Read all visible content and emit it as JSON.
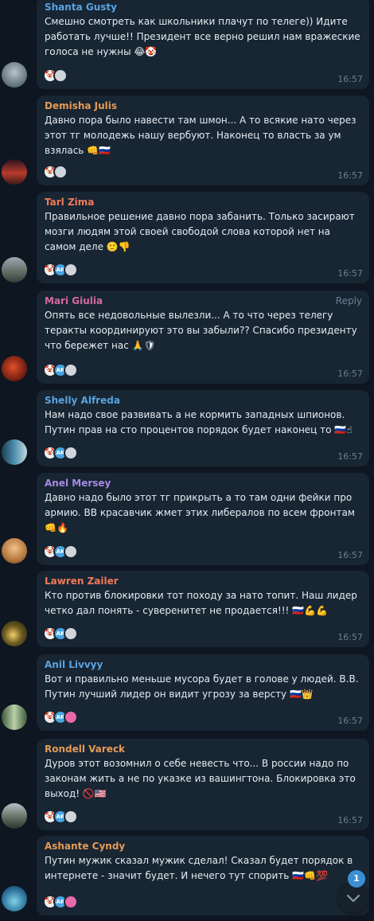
{
  "messages": [
    {
      "author": "Shanta Gusty",
      "color": "#5aa3e0",
      "text": "Смешно смотреть как школьники плачут по телеге)) Идите работать лучше!! Президент все верно решил нам вражеские голоса не нужны 😂🤡",
      "time": "16:57",
      "reactions": [
        "clown",
        "bw"
      ],
      "reply": ""
    },
    {
      "author": "Demisha Julis",
      "color": "#e59b55",
      "text": "Давно пора было навести там шмон... А то всякие нато через этот тг молодежь нашу вербуют. Наконец то власть за ум взялась 👊🇷🇺",
      "time": "16:57",
      "reactions": [
        "clown",
        "bw"
      ],
      "reply": ""
    },
    {
      "author": "Tarl Zima",
      "color": "#f07a5a",
      "text": "Правильное решение давно пора забанить. Только засирают мозги людям этой своей свободой слова которой нет на самом деле 🙂👎",
      "time": "16:57",
      "reactions": [
        "clown",
        "ak",
        "bw"
      ],
      "reply": ""
    },
    {
      "author": "Mari Giulia",
      "color": "#d46ba0",
      "text": "Опять все недовольные вылезли... А то что через телегу теракты координируют это вы забыли?? Спасибо президенту что бережет нас 🙏🛡",
      "time": "16:57",
      "reactions": [
        "clown",
        "ak",
        "bw"
      ],
      "reply": "Reply"
    },
    {
      "author": "Shelly Alfreda",
      "color": "#5aa3e0",
      "text": "Нам надо свое развивать а не кормить западных шпионов. Путин прав на сто процентов порядок будет наконец то 🇷🇺☝",
      "time": "16:57",
      "reactions": [
        "clown",
        "ak",
        "bw"
      ],
      "reply": ""
    },
    {
      "author": "Anel Mersey",
      "color": "#a58ae6",
      "text": "Давно надо было этот тг прикрыть а то там одни фейки про армию. ВВ красавчик жмет этих либералов по всем фронтам 👊🔥",
      "time": "16:57",
      "reactions": [
        "clown",
        "ak",
        "bw"
      ],
      "reply": ""
    },
    {
      "author": "Lawren Zailer",
      "color": "#f07a5a",
      "text": "Кто против блокировки тот походу за нато топит. Наш лидер четко дал понять - суверенитет не продается!!! 🇷🇺💪💪",
      "time": "16:57",
      "reactions": [
        "clown",
        "ak",
        "bw"
      ],
      "reply": ""
    },
    {
      "author": "Anil Livvyy",
      "color": "#5aa3e0",
      "text": "Вот и правильно меньше мусора будет в голове у людей. В.В. Путин лучший лидер он видит угрозу за версту 🇷🇺👑",
      "time": "16:57",
      "reactions": [
        "clown",
        "ak",
        "pink"
      ],
      "reply": ""
    },
    {
      "author": "Rondell Vareck",
      "color": "#e59b55",
      "text": "Дуров этот возомнил о себе невесть что... В россии надо по законам жить а не по указке из вашингтона. Блокировка это выход! 🚫🇺🇸",
      "time": "16:57",
      "reactions": [
        "clown",
        "ak",
        "bw"
      ],
      "reply": ""
    },
    {
      "author": "Ashante Cyndy",
      "color": "#e59b55",
      "text": "Путин мужик сказал мужик сделал! Сказал будет порядок в интернете - значит будет. И нечего тут спорить 🇷🇺👊💯",
      "time": "",
      "reactions": [
        "clown",
        "ak",
        "pink"
      ],
      "reply": ""
    }
  ],
  "scroll_badge": "1",
  "icons": {
    "scroll_down": "chevron-down-icon"
  }
}
